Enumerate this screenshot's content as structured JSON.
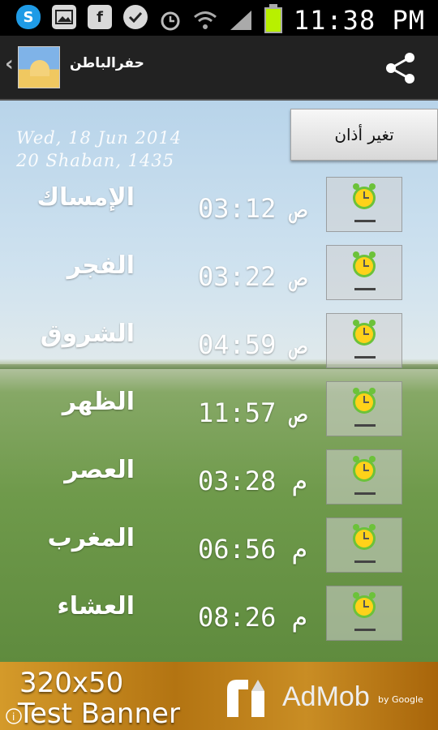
{
  "status_bar": {
    "time": "11:38 PM",
    "icons": [
      "skype-icon",
      "gallery-icon",
      "facebook-icon",
      "messenger-icon",
      "alarm-icon",
      "wifi-icon",
      "signal-icon",
      "battery-icon"
    ],
    "battery_level": 1.0,
    "battery_color": "#b8f000"
  },
  "action_bar": {
    "title": "حفرالباطن",
    "back_icon": "chevron-left-icon",
    "share_icon": "share-icon"
  },
  "header": {
    "date_gregorian": "Wed, 18 Jun 2014",
    "date_hijri": "20 Shaban, 1435",
    "change_adhan_label": "تغير أذان"
  },
  "prayers": [
    {
      "name": "الإمساك",
      "time": "03:12 ص"
    },
    {
      "name": "الفجر",
      "time": "03:22 ص"
    },
    {
      "name": "الشروق",
      "time": "04:59 ص"
    },
    {
      "name": "الظهر",
      "time": "11:57 ص"
    },
    {
      "name": "العصر",
      "time": "03:28 م"
    },
    {
      "name": "المغرب",
      "time": "06:56 م"
    },
    {
      "name": "العشاء",
      "time": "08:26 م"
    }
  ],
  "ad": {
    "size_text": "320x50",
    "banner_text": "Test Banner",
    "brand": "AdMob",
    "by": "by Google"
  },
  "colors": {
    "alarm_yellow": "#ffd21a",
    "alarm_green": "#6cc23a",
    "ad_gold": "#c48a20"
  }
}
